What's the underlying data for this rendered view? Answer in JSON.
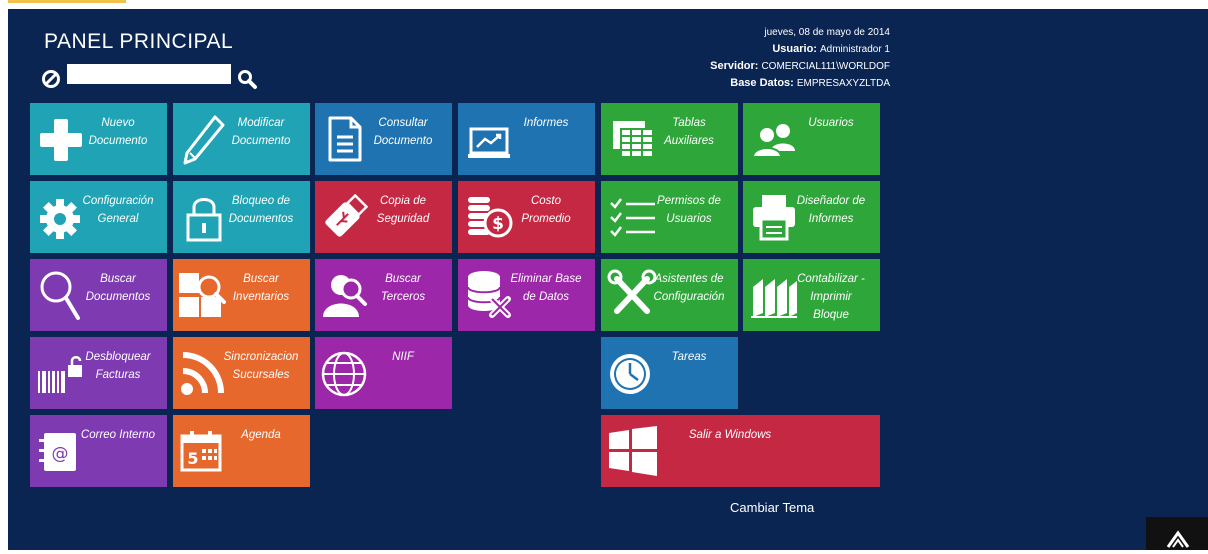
{
  "header": {
    "title": "PANEL PRINCIPAL",
    "search_value": "",
    "date": "jueves, 08 de mayo de 2014",
    "user_label": "Usuario:",
    "user_value": "Administrador 1",
    "server_label": "Servidor:",
    "server_value": "COMERCIAL111\\WORLDOF",
    "db_label": "Base Datos:",
    "db_value": "EMPRESAXYZLTDA"
  },
  "colors": {
    "background": "#0b2552",
    "teal": "#1fa3b5",
    "blue": "#1f73b0",
    "green": "#2ea63a",
    "crimson": "#c52843",
    "purple": "#7e3ab1",
    "orange": "#e6682c",
    "magenta": "#9c27a8"
  },
  "tiles": [
    {
      "id": "nuevo-documento",
      "label": "Nuevo Documento",
      "icon": "plus-icon"
    },
    {
      "id": "modificar-documento",
      "label": "Modificar Documento",
      "icon": "pencil-icon"
    },
    {
      "id": "consultar-documento",
      "label": "Consultar Documento",
      "icon": "document-icon"
    },
    {
      "id": "informes",
      "label": "Informes",
      "icon": "chart-monitor-icon"
    },
    {
      "id": "tablas-auxiliares",
      "label": "Tablas Auxiliares",
      "icon": "spreadsheet-icon"
    },
    {
      "id": "usuarios",
      "label": "Usuarios",
      "icon": "users-icon"
    },
    {
      "id": "configuracion-general",
      "label": "Configuración General",
      "icon": "gear-icon"
    },
    {
      "id": "bloqueo-documentos",
      "label": "Bloqueo de Documentos",
      "icon": "lock-icon"
    },
    {
      "id": "copia-seguridad",
      "label": "Copia de Seguridad",
      "icon": "usb-drive-icon"
    },
    {
      "id": "costo-promedio",
      "label": "Costo Promedio",
      "icon": "coins-icon"
    },
    {
      "id": "permisos-usuarios",
      "label": "Permisos de Usuarios",
      "icon": "checklist-icon"
    },
    {
      "id": "disenador-informes",
      "label": "Diseñador de Informes",
      "icon": "printer-icon"
    },
    {
      "id": "buscar-documentos",
      "label": "Buscar Documentos",
      "icon": "magnifier-icon"
    },
    {
      "id": "buscar-inventarios",
      "label": "Buscar Inventarios",
      "icon": "inventory-search-icon"
    },
    {
      "id": "buscar-terceros",
      "label": "Buscar Terceros",
      "icon": "person-search-icon"
    },
    {
      "id": "eliminar-base-datos",
      "label": "Eliminar Base de Datos",
      "icon": "database-delete-icon"
    },
    {
      "id": "asistentes-configuracion",
      "label": "Asistentes de Configuración",
      "icon": "tools-icon"
    },
    {
      "id": "contabilizar-imprimir",
      "label": "Contabilizar - Imprimir Bloque",
      "icon": "binders-icon"
    },
    {
      "id": "desbloquear-facturas",
      "label": "Desbloquear Facturas",
      "icon": "barcode-unlock-icon"
    },
    {
      "id": "sincronizacion-sucursales",
      "label": "Sincronizacion Sucursales",
      "icon": "rss-icon"
    },
    {
      "id": "niif",
      "label": "NIIF",
      "icon": "globe-icon"
    },
    {
      "id": "tareas",
      "label": "Tareas",
      "icon": "clock-icon"
    },
    {
      "id": "correo-interno",
      "label": "Correo Interno",
      "icon": "address-book-icon"
    },
    {
      "id": "agenda",
      "label": "Agenda",
      "icon": "calendar-icon"
    },
    {
      "id": "salir-windows",
      "label": "Salir a Windows",
      "icon": "windows-icon"
    }
  ],
  "footer": {
    "cambiar_tema": "Cambiar Tema",
    "corner_icon": "chevron-up-icon"
  }
}
